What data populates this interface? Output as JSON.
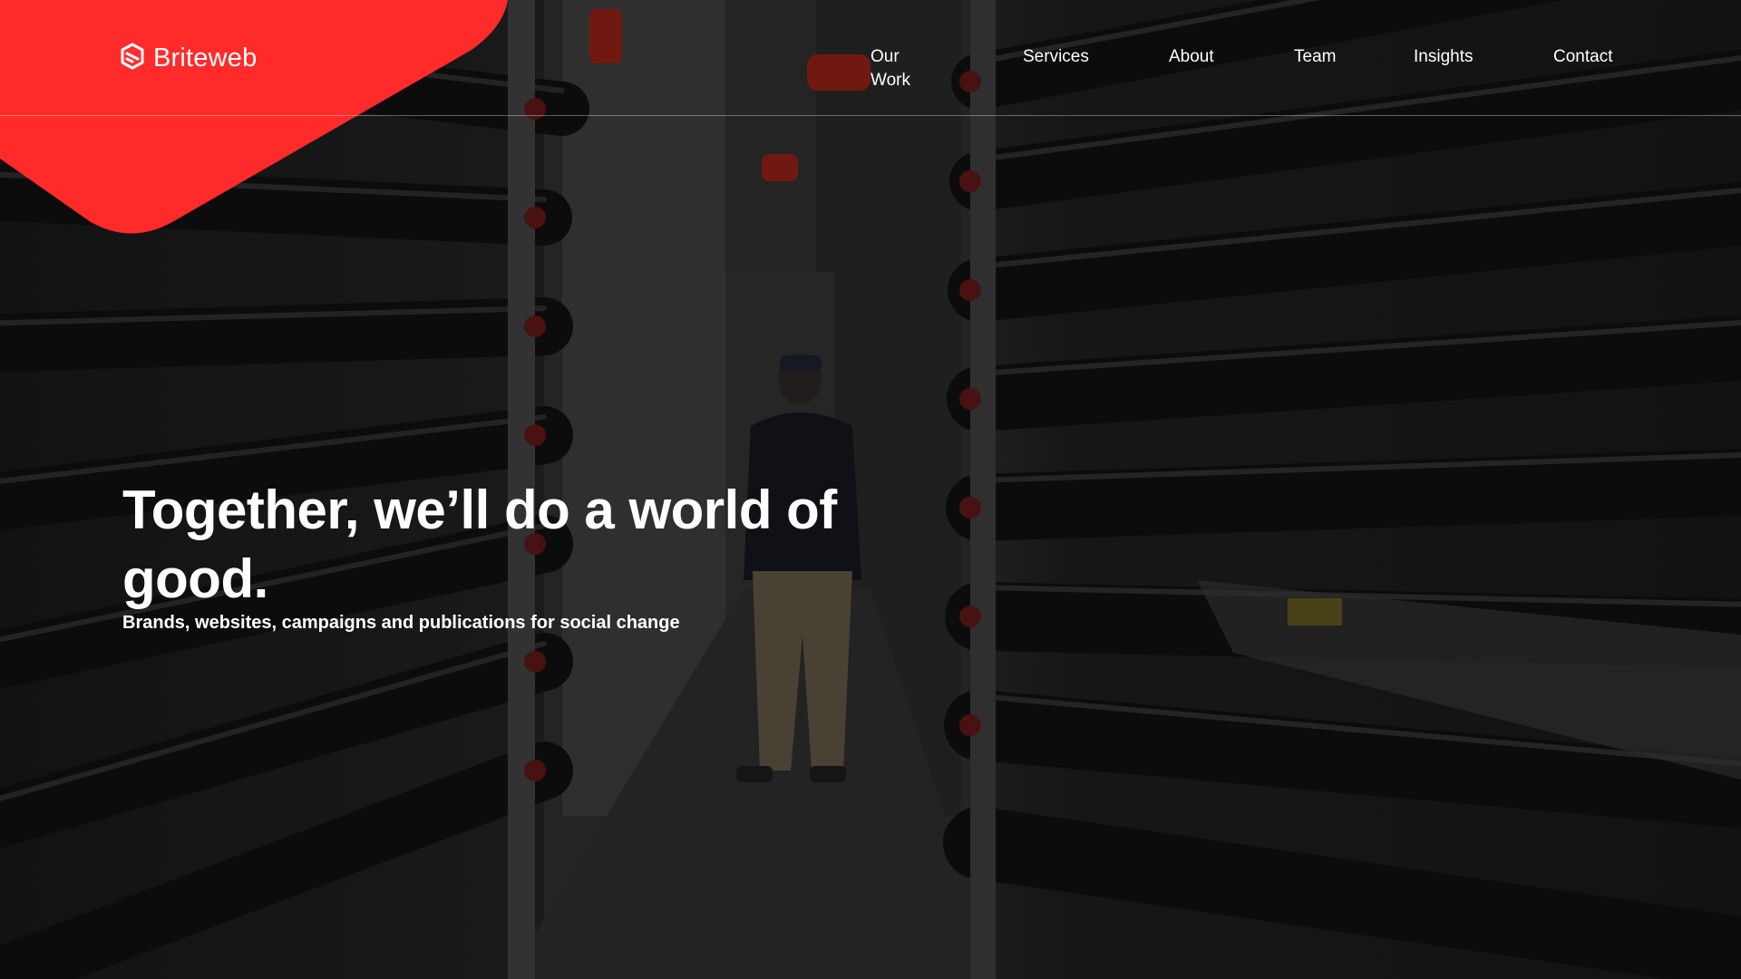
{
  "brand": {
    "name": "Briteweb",
    "accent_color": "#ff2a2a",
    "logo_icon": "briteweb-logo-icon"
  },
  "nav": {
    "items": [
      {
        "label": "Our Work"
      },
      {
        "label": "Services"
      },
      {
        "label": "About"
      },
      {
        "label": "Team"
      },
      {
        "label": "Insights"
      },
      {
        "label": "Contact"
      }
    ]
  },
  "hero": {
    "title": "Together, we’ll do a world of good.",
    "subtitle": "Brands, websites, campaigns and publications for social change",
    "background": "industrial-corridor-with-pipes-and-person"
  }
}
